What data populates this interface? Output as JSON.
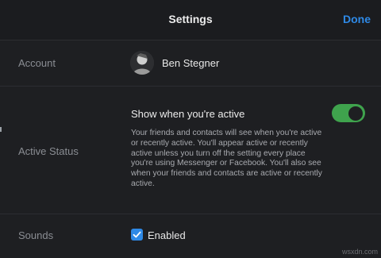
{
  "header": {
    "title": "Settings",
    "done_label": "Done"
  },
  "account": {
    "label": "Account",
    "name": "Ben Stegner",
    "avatar_icon": "user-avatar"
  },
  "active_status": {
    "label": "Active Status",
    "toggle_title": "Show when you're active",
    "enabled": true,
    "description": "Your friends and contacts will see when you're active or recently active. You'll appear active or recently active unless you turn off the setting every place you're using Messenger or Facebook. You'll also see when your friends and contacts are active or recently active."
  },
  "sounds": {
    "label": "Sounds",
    "checkbox_label": "Enabled",
    "checked": true
  },
  "watermark": "wsxdn.com",
  "colors": {
    "accent": "#2e89e6",
    "toggle_on": "#3fa34d",
    "background": "#1e1f22"
  }
}
